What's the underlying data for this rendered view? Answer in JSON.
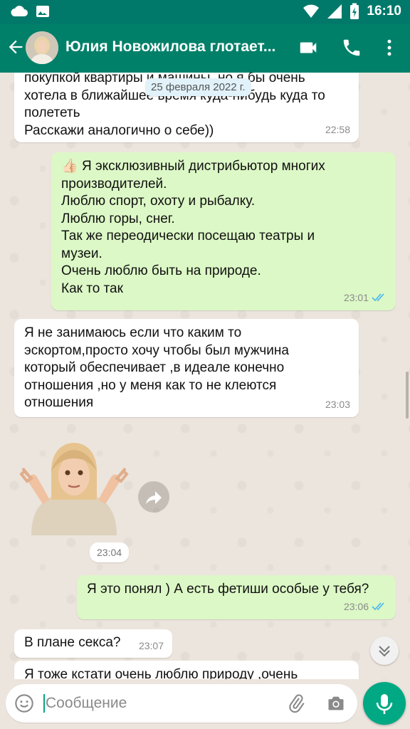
{
  "status_bar": {
    "time": "16:10",
    "icons": [
      "cloud-icon",
      "image-icon",
      "wifi-icon",
      "signal-icon",
      "battery-charging-icon"
    ]
  },
  "header": {
    "title": "Юлия Новожилова глотает...",
    "icons": [
      "back-arrow-icon",
      "video-call-icon",
      "phone-call-icon",
      "more-vert-icon"
    ]
  },
  "chat": {
    "date_chip": "25 февраля 2022 г.",
    "messages": [
      {
        "direction": "in",
        "text": "покупкой квартиры и машины, но я бы очень\nхотела в ближайшее время куда-нибудь куда то\nполететь\nРасскажи аналогично о себе))",
        "time": "22:58"
      },
      {
        "direction": "out",
        "emoji": "👍🏻",
        "text": " Я эксклюзивный дистрибьютор многих\nпроизводителей.\nЛюблю спорт, охоту и рыбалку.\nЛюблю горы, снег.\nТак же переодически посещаю театры и\nмузеи.\nОчень люблю быть на природе.\nКак то так",
        "time": "23:01",
        "status": "read"
      },
      {
        "direction": "in",
        "text": "Я не занимаюсь если что каким то\nэскортом,просто хочу чтобы был мужчина\nкоторый обеспечивает ,в идеале конечно\nотношения ,но у меня как то не клеются\nотношения",
        "time": "23:03"
      },
      {
        "direction": "in",
        "type": "sticker",
        "sticker_name": "shrug-memoji-sticker",
        "time": "23:04"
      },
      {
        "direction": "out",
        "text": "Я это понял ) А есть фетиши особые у тебя?",
        "time": "23:06",
        "status": "read"
      },
      {
        "direction": "in",
        "text": "В плане секса?",
        "time": "23:07"
      },
      {
        "direction": "in",
        "text": "Я тоже кстати очень люблю природу ,очень"
      }
    ]
  },
  "composer": {
    "placeholder": "Сообщение",
    "value": ""
  },
  "colors": {
    "header": "#008069",
    "status_bar": "#00796b",
    "incoming_bubble": "#ffffff",
    "outgoing_bubble": "#dcf8c6",
    "read_ticks": "#53bdeb",
    "accent": "#00a884",
    "wallpaper": "#ece5dd"
  }
}
